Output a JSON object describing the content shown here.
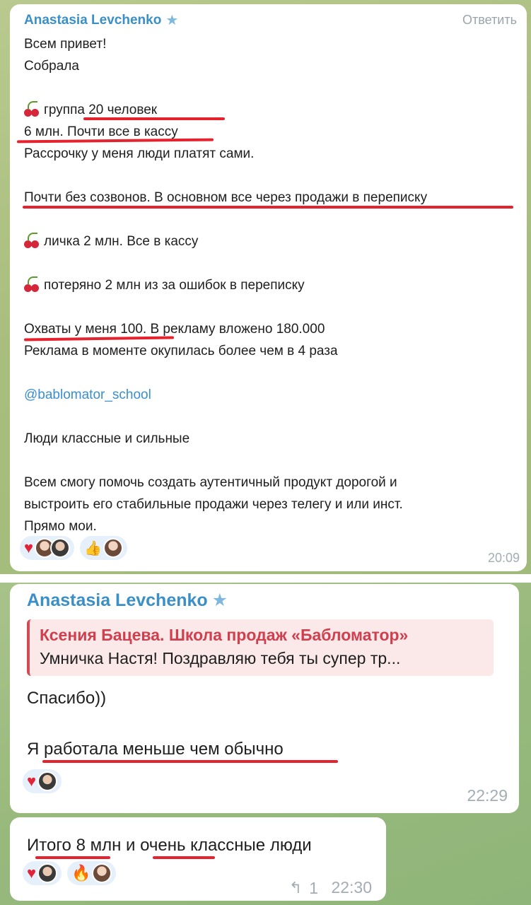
{
  "message1": {
    "sender": "Anastasia Levchenko",
    "reply_label": "Ответить",
    "lines": [
      "Всем привет!",
      "Собрала",
      "",
      "группа 20 человек",
      "6 млн. Почти все в кассу",
      "Рассрочку у меня люди платят сами.",
      "",
      "Почти без созвонов. В основном все через продажи в переписку",
      "",
      "личка 2 млн. Все в кассу",
      "",
      "потеряно 2 млн из за ошибок в переписку",
      "",
      "Охваты у меня 100. В рекламу вложено 180.000",
      "Реклама в моменте окупилась более чем в 4 раза",
      "",
      "@bablomator_school",
      "",
      "Люди классные и сильные",
      "",
      "Всем смогу помочь создать аутентичный продукт дорогой и",
      "выстроить его стабильные продажи через телегу и или инст.",
      "Прямо мои."
    ],
    "time": "20:09"
  },
  "message2": {
    "sender": "Anastasia Levchenko",
    "quote_author": "Ксения Бацева. Школа продаж «Бабломатор»",
    "quote_text": "Умничка Настя! Поздравляю тебя ты супер тр...",
    "line1": "Спасибо))",
    "line2": "Я работала меньше чем обычно",
    "time": "22:29"
  },
  "message3": {
    "text": "Итого 8 млн и очень классные люди",
    "forward_count": "1",
    "time": "22:30"
  },
  "icons": {
    "star": "★",
    "heart": "♥",
    "thumb": "👍",
    "fire": "🔥",
    "forward": "↰"
  },
  "colors": {
    "sender": "#3a8fc6",
    "underline": "#e4232f",
    "quote_accent": "#d24a55",
    "chat_bg": "#a9be7e"
  }
}
